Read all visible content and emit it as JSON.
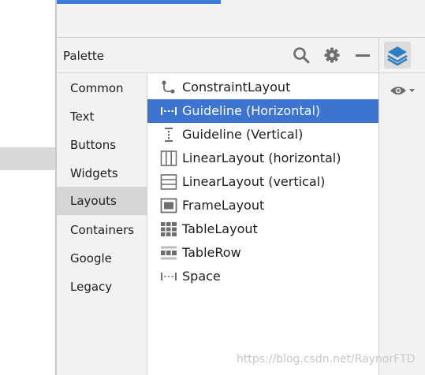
{
  "palette": {
    "title": "Palette",
    "icons": [
      "search-icon",
      "gear-icon",
      "minimize-icon"
    ]
  },
  "categories": [
    {
      "label": "Common"
    },
    {
      "label": "Text"
    },
    {
      "label": "Buttons"
    },
    {
      "label": "Widgets"
    },
    {
      "label": "Layouts",
      "selected": true
    },
    {
      "label": "Containers"
    },
    {
      "label": "Google"
    },
    {
      "label": "Legacy"
    }
  ],
  "components": [
    {
      "label": "ConstraintLayout",
      "icon": "constraint-layout-icon"
    },
    {
      "label": "Guideline (Horizontal)",
      "icon": "guideline-horizontal-icon",
      "selected": true
    },
    {
      "label": "Guideline (Vertical)",
      "icon": "guideline-vertical-icon"
    },
    {
      "label": "LinearLayout (horizontal)",
      "icon": "linear-layout-horizontal-icon"
    },
    {
      "label": "LinearLayout (vertical)",
      "icon": "linear-layout-vertical-icon"
    },
    {
      "label": "FrameLayout",
      "icon": "frame-layout-icon"
    },
    {
      "label": "TableLayout",
      "icon": "table-layout-icon"
    },
    {
      "label": "TableRow",
      "icon": "table-row-icon"
    },
    {
      "label": "Space",
      "icon": "space-icon"
    }
  ],
  "side_panel": {
    "icons": [
      "layers-icon",
      "eye-icon"
    ]
  },
  "watermark": "https://blog.csdn.net/RaynorFTD",
  "colors": {
    "accent": "#3d74cf",
    "panel_bg": "#f2f2f2",
    "selected_category_bg": "#d6d6d6",
    "icon_gray": "#6e6e6e"
  }
}
